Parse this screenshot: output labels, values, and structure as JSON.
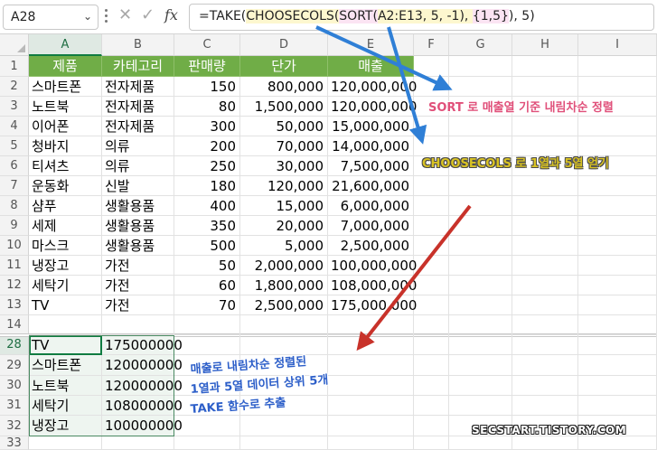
{
  "formula_bar": {
    "name_box": "A28",
    "fx_label": "fx",
    "formula_parts": [
      {
        "text": "=TAKE(",
        "hl": ""
      },
      {
        "text": "CHOOSECOLS(",
        "hl": "y"
      },
      {
        "text": "SORT(",
        "hl": "p"
      },
      {
        "text": "A2:E13, 5, -1), ",
        "hl": "y"
      },
      {
        "text": "{1,5}",
        "hl": "p"
      },
      {
        "text": "), 5)",
        "hl": ""
      }
    ]
  },
  "columns": [
    "A",
    "B",
    "C",
    "D",
    "E",
    "F",
    "G",
    "H",
    "I"
  ],
  "row_numbers": [
    "1",
    "2",
    "3",
    "4",
    "5",
    "6",
    "7",
    "8",
    "9",
    "10",
    "11",
    "12",
    "13",
    "14",
    "28",
    "29",
    "30",
    "31",
    "32",
    "33"
  ],
  "header_row": [
    "제품",
    "카테고리",
    "판매량",
    "단가",
    "매출"
  ],
  "table": [
    [
      "스마트폰",
      "전자제품",
      "150",
      "800,000",
      "120,000,000"
    ],
    [
      "노트북",
      "전자제품",
      "80",
      "1,500,000",
      "120,000,000"
    ],
    [
      "이어폰",
      "전자제품",
      "300",
      "50,000",
      "15,000,000"
    ],
    [
      "청바지",
      "의류",
      "200",
      "70,000",
      "14,000,000"
    ],
    [
      "티셔츠",
      "의류",
      "250",
      "30,000",
      "7,500,000"
    ],
    [
      "운동화",
      "신발",
      "180",
      "120,000",
      "21,600,000"
    ],
    [
      "샴푸",
      "생활용품",
      "400",
      "15,000",
      "6,000,000"
    ],
    [
      "세제",
      "생활용품",
      "350",
      "20,000",
      "7,000,000"
    ],
    [
      "마스크",
      "생활용품",
      "500",
      "5,000",
      "2,500,000"
    ],
    [
      "냉장고",
      "가전",
      "50",
      "2,000,000",
      "100,000,000"
    ],
    [
      "세탁기",
      "가전",
      "60",
      "1,800,000",
      "108,000,000"
    ],
    [
      "TV",
      "가전",
      "70",
      "2,500,000",
      "175,000,000"
    ]
  ],
  "result": [
    [
      "TV",
      "175000000"
    ],
    [
      "스마트폰",
      "120000000"
    ],
    [
      "노트북",
      "120000000"
    ],
    [
      "세탁기",
      "108000000"
    ],
    [
      "냉장고",
      "100000000"
    ]
  ],
  "annotations": {
    "sort_note": "SORT 로 매출열 기준 내림차순 정렬",
    "choosecols_note": "CHOOSECOLS 로 1열과 5열 얻기",
    "take_note": [
      "매출로 내림차순 정렬된",
      "1열과 5열 데이터 상위 5개",
      "TAKE 함수로 추출"
    ]
  },
  "watermark": "SECSTART.TISTORY.COM",
  "colors": {
    "header_green": "#70ad47",
    "active_border": "#107c41",
    "arrow_blue": "#2f7fd6",
    "arrow_red": "#c8322a"
  }
}
